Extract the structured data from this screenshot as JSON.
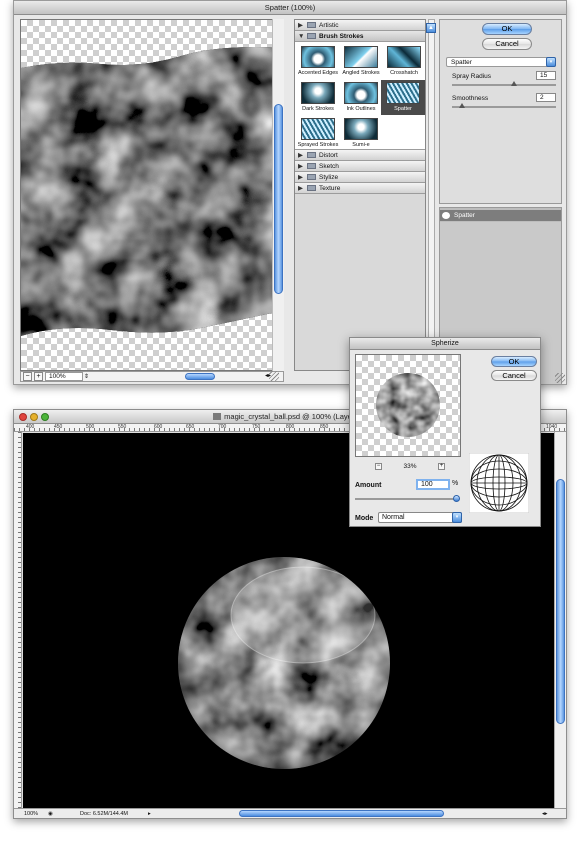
{
  "spatter_dialog": {
    "title": "Spatter (100%)",
    "zoom": "100%",
    "ok_label": "OK",
    "cancel_label": "Cancel",
    "categories": {
      "artistic": "Artistic",
      "brush_strokes": "Brush Strokes",
      "distort": "Distort",
      "sketch": "Sketch",
      "stylize": "Stylize",
      "texture": "Texture"
    },
    "thumbnails": [
      "Accented Edges",
      "Angled Strokes",
      "Crosshatch",
      "Dark Strokes",
      "Ink Outlines",
      "Spatter",
      "Sprayed Strokes",
      "Sumi-e"
    ],
    "selected_filter": "Spatter",
    "params": {
      "spray_radius_label": "Spray Radius",
      "spray_radius_value": "15",
      "spray_radius_level": 0.6,
      "smoothness_label": "Smoothness",
      "smoothness_value": "2",
      "smoothness_level": 0.1
    },
    "layer_name": "Spatter"
  },
  "document_window": {
    "title": "magic_crystal_ball.psd @ 100% (Layer 15,",
    "ruler_numbers": [
      "400",
      "450",
      "500",
      "550",
      "600",
      "650",
      "700",
      "750",
      "800",
      "850",
      "900",
      "1000",
      "1040"
    ],
    "status_zoom": "100%",
    "doc_info": "Doc: 6.52M/144.4M"
  },
  "spherize_dialog": {
    "title": "Spherize",
    "ok_label": "OK",
    "cancel_label": "Cancel",
    "zoom": "33%",
    "amount_label": "Amount",
    "amount_value": "100",
    "amount_unit": "%",
    "amount_level": 1.0,
    "mode_label": "Mode",
    "mode_value": "Normal"
  },
  "colors": {
    "accent_blue": "#5b9de8",
    "canvas_black": "#000000",
    "close_red": "#e0443e",
    "minimize_yellow": "#e6b02a",
    "zoom_green": "#4cb43a"
  }
}
